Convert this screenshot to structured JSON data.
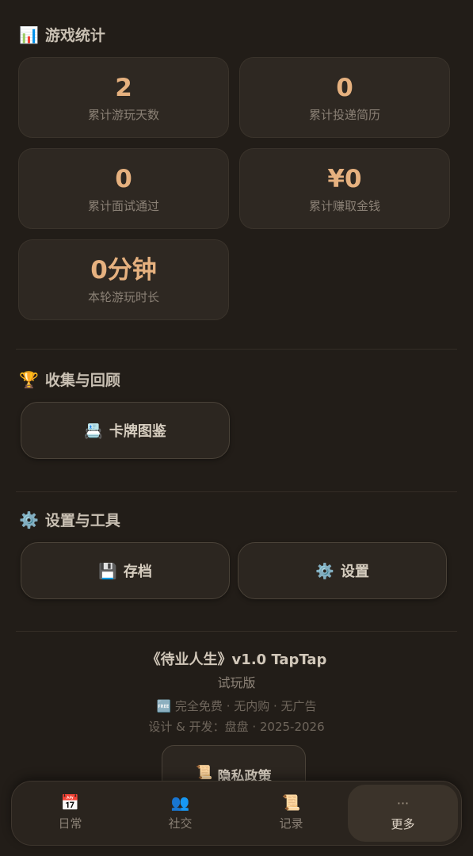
{
  "stats": {
    "title": "游戏统计",
    "icon": "bar-chart-icon",
    "icon_glyph": "📊",
    "cards": [
      {
        "value": "2",
        "label": "累计游玩天数"
      },
      {
        "value": "0",
        "label": "累计投递简历"
      },
      {
        "value": "0",
        "label": "累计面试通过"
      },
      {
        "value": "¥0",
        "label": "累计赚取金钱"
      },
      {
        "value": "0分钟",
        "label": "本轮游玩时长"
      }
    ]
  },
  "collection": {
    "title": "收集与回顾",
    "icon": "trophy-icon",
    "icon_glyph": "🏆",
    "card_gallery_label": "卡牌图鉴",
    "card_gallery_icon": "📇"
  },
  "tools": {
    "title": "设置与工具",
    "icon": "gear-icon",
    "icon_glyph": "⚙️",
    "save_label": "存档",
    "save_icon": "💾",
    "settings_label": "设置",
    "settings_icon": "⚙️"
  },
  "footer": {
    "title": "《待业人生》v1.0 TapTap",
    "subtitle": "试玩版",
    "line1_icon": "🆓",
    "line1": "完全免费 · 无内购 · 无广告",
    "line2": "设计 & 开发：盘盘 · 2025-2026",
    "privacy_label": "隐私政策",
    "privacy_icon": "📜"
  },
  "tabbar": {
    "tabs": [
      {
        "label": "日常",
        "icon": "calendar-icon",
        "glyph": "📅"
      },
      {
        "label": "社交",
        "icon": "people-icon",
        "glyph": "👥"
      },
      {
        "label": "记录",
        "icon": "scroll-icon",
        "glyph": "📜"
      },
      {
        "label": "更多",
        "icon": "more-icon",
        "glyph": "···"
      }
    ],
    "active_index": 3
  },
  "colors": {
    "background": "#221d18",
    "card": "#2e2822",
    "accent": "#e6b17f"
  }
}
